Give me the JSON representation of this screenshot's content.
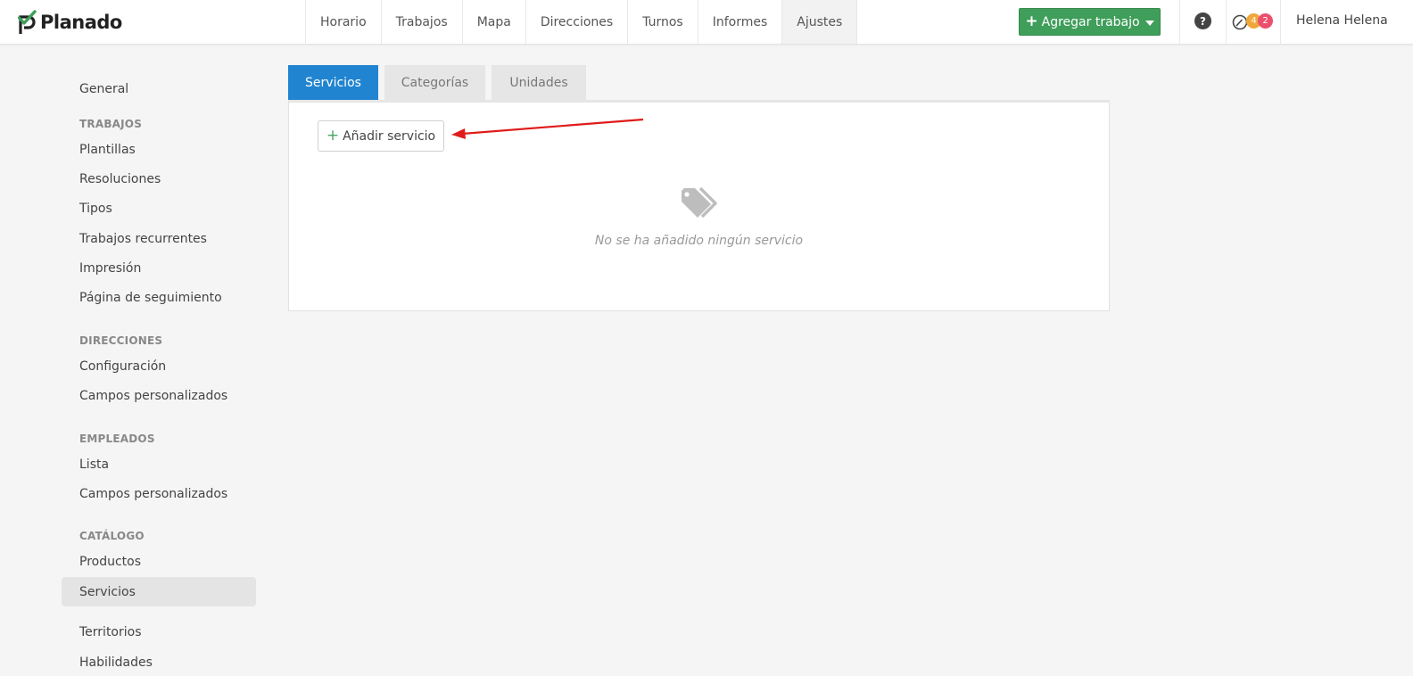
{
  "brand": {
    "name": "Planado",
    "accent": "#3f9e5a"
  },
  "nav": [
    "Horario",
    "Trabajos",
    "Mapa",
    "Direcciones",
    "Turnos",
    "Informes",
    "Ajustes"
  ],
  "active_nav": "Ajustes",
  "header": {
    "add_job_label": "Agregar trabajo",
    "help_label": "?",
    "badge_orange": "4",
    "badge_red": "2",
    "user_name": "Helena Helena"
  },
  "sidebar": {
    "general": "General",
    "trabajos_head": "TRABAJOS",
    "plantillas": "Plantillas",
    "resoluciones": "Resoluciones",
    "tipos": "Tipos",
    "recurrentes": "Trabajos recurrentes",
    "impresion": "Impresión",
    "seguimiento": "Página de seguimiento",
    "direcciones_head": "DIRECCIONES",
    "configuracion": "Configuración",
    "campos_dir": "Campos personalizados",
    "empleados_head": "EMPLEADOS",
    "lista": "Lista",
    "campos_emp": "Campos personalizados",
    "catalogo_head": "CATÁLOGO",
    "productos": "Productos",
    "servicios": "Servicios",
    "territorios": "Territorios",
    "habilidades": "Habilidades"
  },
  "tabs": {
    "servicios": "Servicios",
    "categorias": "Categorías",
    "unidades": "Unidades"
  },
  "content": {
    "add_service_label": "Añadir servicio",
    "empty_message": "No se ha añadido ningún servicio",
    "empty_icon": "tags-icon"
  }
}
